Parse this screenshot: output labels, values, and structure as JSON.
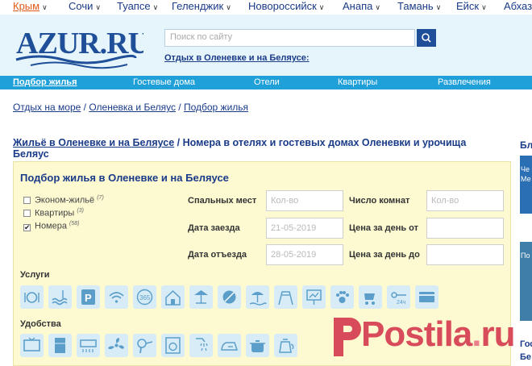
{
  "cities": [
    {
      "label": "Крым",
      "active": true
    },
    {
      "label": "Сочи"
    },
    {
      "label": "Туапсе"
    },
    {
      "label": "Геленджик"
    },
    {
      "label": "Новороссийск"
    },
    {
      "label": "Анапа"
    },
    {
      "label": "Тамань"
    },
    {
      "label": "Ейск"
    },
    {
      "label": "Абхаз"
    }
  ],
  "header": {
    "logo_text": "AZUR.RU",
    "search_placeholder": "Поиск по сайту",
    "link": "Отдых в Оленевке и на Беляусе:"
  },
  "nav": [
    "Подбор жилья",
    "Гостевые дома",
    "Отели",
    "Квартиры",
    "Развлечения"
  ],
  "breadcrumb": {
    "items": [
      "Отдых на море",
      "Оленевка и Беляус",
      "Подбор жилья"
    ],
    "sep": " / "
  },
  "page_title": {
    "link": "Жильё в Оленевке и на Беляусе",
    "rest": " / Номера в отелях и гостевых домах Оленевки и урочища Беляус"
  },
  "filter": {
    "title": "Подбор жилья в Оленевке и на Беляусе",
    "checkboxes": [
      {
        "label": "Эконом-жильё",
        "count": "(7)",
        "checked": false
      },
      {
        "label": "Квартиры",
        "count": "(3)",
        "checked": false
      },
      {
        "label": "Номера",
        "count": "(58)",
        "checked": true
      }
    ],
    "fields": {
      "bedrooms_label": "Спальных мест",
      "bedrooms_placeholder": "Кол-во",
      "rooms_label": "Число комнат",
      "rooms_placeholder": "Кол-во",
      "checkin_label": "Дата заезда",
      "checkin_value": "21-05-2019",
      "price_from_label": "Цена за день от",
      "checkout_label": "Дата отъезда",
      "checkout_value": "28-05-2019",
      "price_to_label": "Цена за день до"
    },
    "services_label": "Услуги",
    "services_icons": [
      "meal-icon",
      "pool-icon",
      "parking-icon",
      "wifi-icon",
      "year-round-icon",
      "guesthouse-icon",
      "cafe-icon",
      "billiards-icon",
      "beach-icon",
      "playground-icon",
      "conference-icon",
      "pets-icon",
      "stroller-icon",
      "24h-icon",
      "card-icon"
    ],
    "amenities_label": "Удобства",
    "amenities_icons": [
      "tv-icon",
      "fridge-icon",
      "aircon-icon",
      "fan-icon",
      "hairdryer-icon",
      "washer-icon",
      "shower-icon",
      "iron-icon",
      "pot-icon",
      "kettle-icon"
    ]
  },
  "sidebar": {
    "top_label": "Бл",
    "img1_lines": [
      "Че",
      "Ме"
    ],
    "img2_text": "По",
    "bottom_lines": [
      "Гос",
      "Бе"
    ]
  },
  "watermark": {
    "text": "Postila",
    "dot": ".",
    "tld": "ru"
  },
  "colors": {
    "brand": "#1a3b88",
    "nav_bg": "#1fa0d8",
    "header_bg": "#e6f4fb",
    "panel_bg": "#fdfad2",
    "active_city": "#e05a1a"
  }
}
